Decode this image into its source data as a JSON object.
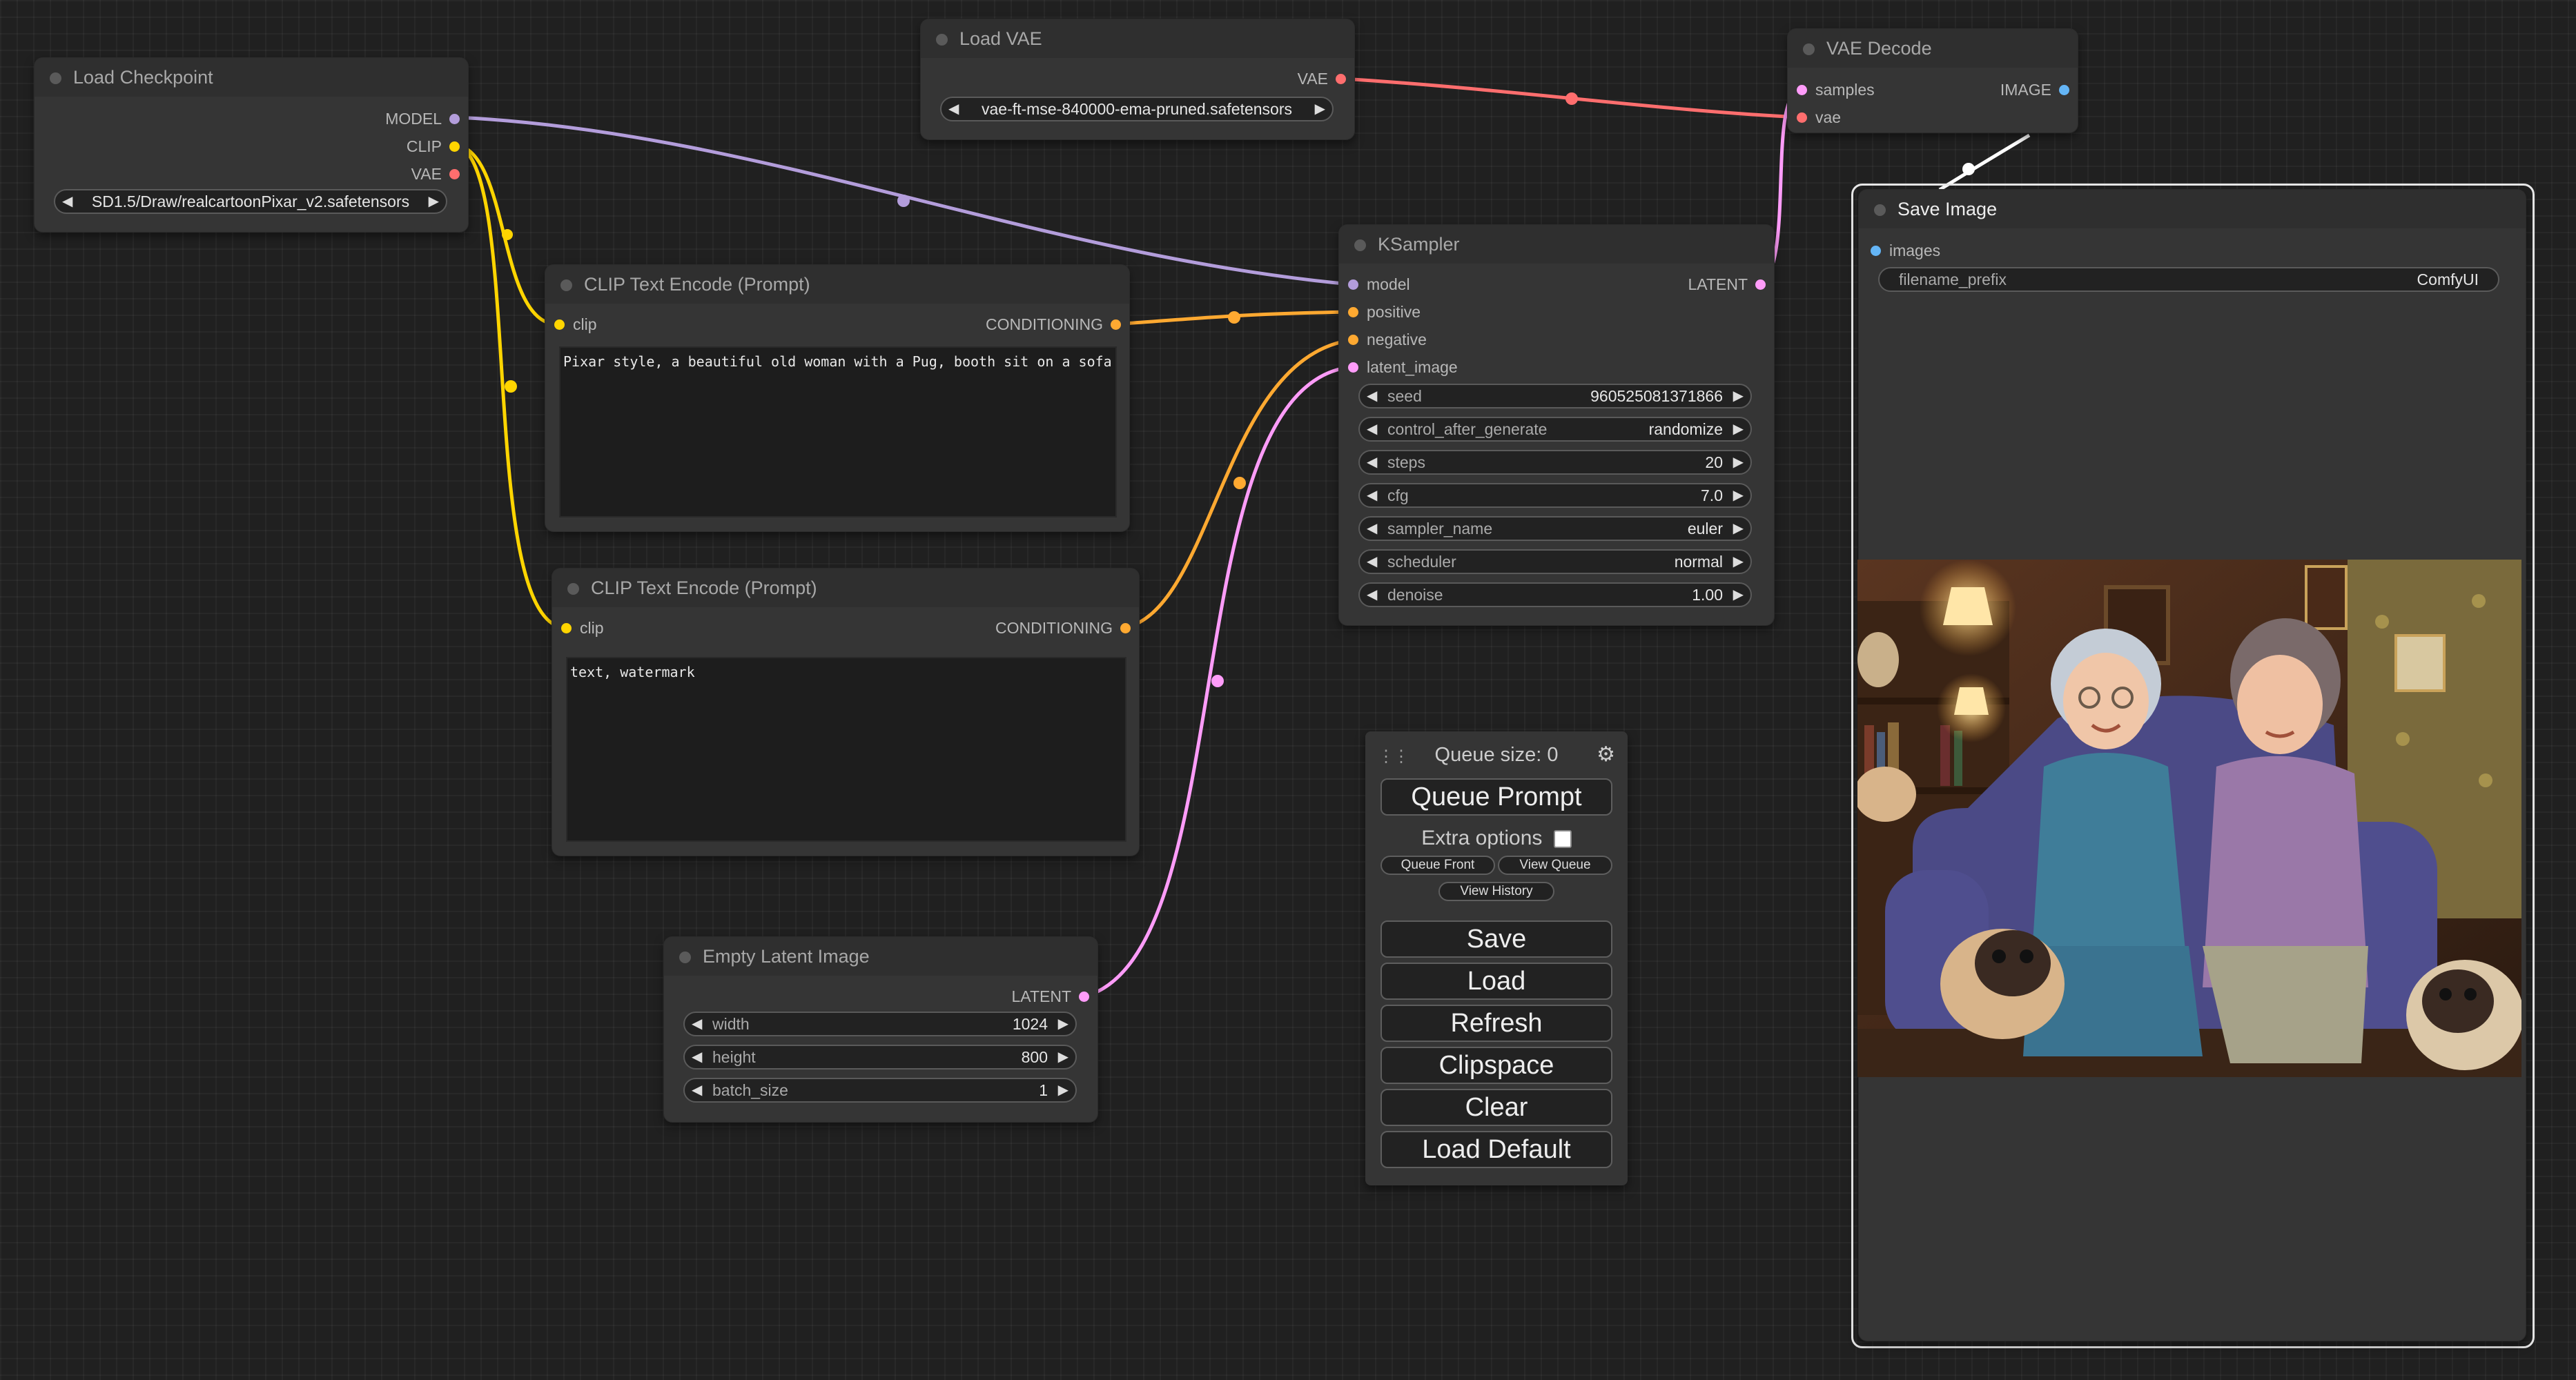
{
  "nodes": {
    "load_checkpoint": {
      "title": "Load Checkpoint",
      "outputs": [
        "MODEL",
        "CLIP",
        "VAE"
      ],
      "ckpt_name": "SD1.5/Draw/realcartoonPixar_v2.safetensors"
    },
    "load_vae": {
      "title": "Load VAE",
      "output": "VAE",
      "vae_name": "vae-ft-mse-840000-ema-pruned.safetensors"
    },
    "vae_decode": {
      "title": "VAE Decode",
      "inputs": [
        "samples",
        "vae"
      ],
      "output": "IMAGE"
    },
    "clip_text_positive": {
      "title": "CLIP Text Encode (Prompt)",
      "input": "clip",
      "output": "CONDITIONING",
      "text": "Pixar style, a beautiful old woman with a Pug, booth sit on a sofa"
    },
    "clip_text_negative": {
      "title": "CLIP Text Encode (Prompt)",
      "input": "clip",
      "output": "CONDITIONING",
      "text": "text, watermark"
    },
    "ksampler": {
      "title": "KSampler",
      "inputs": [
        "model",
        "positive",
        "negative",
        "latent_image"
      ],
      "output": "LATENT",
      "widgets": [
        {
          "label": "seed",
          "value": "960525081371866"
        },
        {
          "label": "control_after_generate",
          "value": "randomize"
        },
        {
          "label": "steps",
          "value": "20"
        },
        {
          "label": "cfg",
          "value": "7.0"
        },
        {
          "label": "sampler_name",
          "value": "euler"
        },
        {
          "label": "scheduler",
          "value": "normal"
        },
        {
          "label": "denoise",
          "value": "1.00"
        }
      ]
    },
    "empty_latent": {
      "title": "Empty Latent Image",
      "output": "LATENT",
      "widgets": [
        {
          "label": "width",
          "value": "1024"
        },
        {
          "label": "height",
          "value": "800"
        },
        {
          "label": "batch_size",
          "value": "1"
        }
      ]
    },
    "save_image": {
      "title": "Save Image",
      "input": "images",
      "filename_prefix_label": "filename_prefix",
      "filename_prefix": "ComfyUI"
    }
  },
  "menu": {
    "queue_size": "Queue size: 0",
    "queue_prompt": "Queue Prompt",
    "extra_options": "Extra options",
    "queue_front": "Queue Front",
    "view_queue": "View Queue",
    "view_history": "View History",
    "save": "Save",
    "load": "Load",
    "refresh": "Refresh",
    "clipspace": "Clipspace",
    "clear": "Clear",
    "load_default": "Load Default"
  },
  "colors": {
    "model": "#b39ddb",
    "clip": "#ffd500",
    "vae": "#ff6e6e",
    "conditioning": "#ffa931",
    "latent": "#ff9cf9",
    "image": "#64b5f6"
  },
  "icons": {
    "drag": "drag-handle-icon",
    "settings": "gear-icon"
  }
}
